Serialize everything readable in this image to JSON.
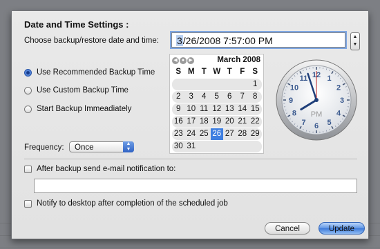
{
  "dialog": {
    "title": "Date and Time Settings :",
    "prompt": "Choose backup/restore date and time:",
    "datetime_month": "3",
    "datetime_rest": "/26/2008   7:57:00 PM"
  },
  "options": {
    "recommended": "Use Recommended Backup Time",
    "custom": "Use Custom Backup Time",
    "immediate": "Start Backup Immeadiately"
  },
  "frequency": {
    "label": "Frequency:",
    "value": "Once"
  },
  "calendar": {
    "month": "March 2008",
    "weekdays": [
      "S",
      "M",
      "T",
      "W",
      "T",
      "F",
      "S"
    ],
    "weeks": [
      [
        "",
        "",
        "",
        "",
        "",
        "",
        "1"
      ],
      [
        "2",
        "3",
        "4",
        "5",
        "6",
        "7",
        "8"
      ],
      [
        "9",
        "10",
        "11",
        "12",
        "13",
        "14",
        "15"
      ],
      [
        "16",
        "17",
        "18",
        "19",
        "20",
        "21",
        "22"
      ],
      [
        "23",
        "24",
        "25",
        "26",
        "27",
        "28",
        "29"
      ],
      [
        "30",
        "31",
        "",
        "",
        "",
        "",
        ""
      ]
    ],
    "selected_day": "26"
  },
  "clock": {
    "period": "PM",
    "numerals": [
      "12",
      "1",
      "2",
      "3",
      "4",
      "5",
      "6",
      "7",
      "8",
      "9",
      "10",
      "11"
    ],
    "hour": 7,
    "minute": 57,
    "second": 0
  },
  "notify": {
    "email_label": "After backup send e-mail notification to:",
    "email_value": "",
    "desktop_label": "Notify to desktop after completion of the scheduled job"
  },
  "buttons": {
    "cancel": "Cancel",
    "update": "Update"
  },
  "colors": {
    "accent": "#3f7fe0",
    "focus_ring": "#7ea7e4"
  }
}
